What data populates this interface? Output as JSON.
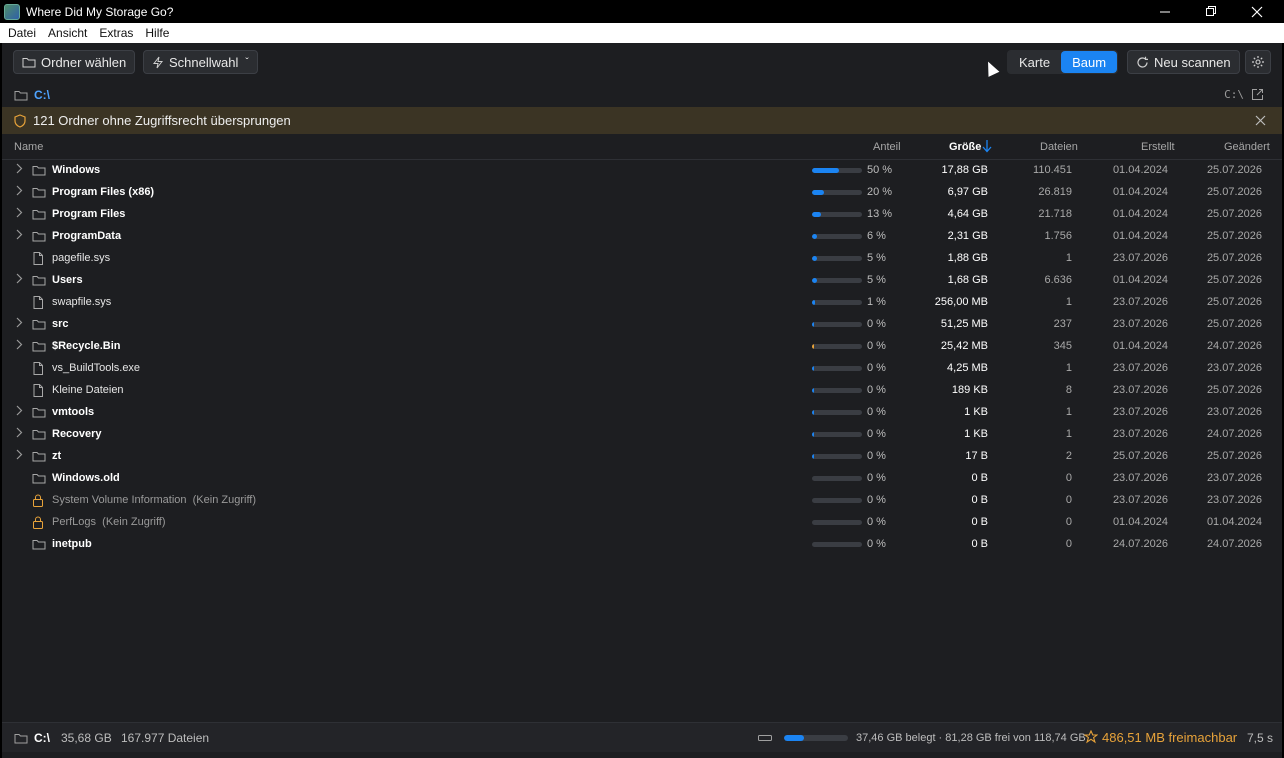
{
  "window": {
    "title": "Where Did My Storage Go?"
  },
  "menu": [
    "Datei",
    "Ansicht",
    "Extras",
    "Hilfe"
  ],
  "toolbar": {
    "choose_folder": "Ordner wählen",
    "quick_select": "Schnellwahl",
    "view_map": "Karte",
    "view_tree": "Baum",
    "rescan": "Neu scannen"
  },
  "path": {
    "current": "C:\\",
    "drive_label": "C:\\"
  },
  "warning": {
    "text": "121 Ordner ohne Zugriffsrecht übersprungen"
  },
  "columns": {
    "name": "Name",
    "share": "Anteil",
    "size": "Größe",
    "files": "Dateien",
    "created": "Erstellt",
    "changed": "Geändert"
  },
  "accent_color": "#1b84f2",
  "warning_color": "#e8a33a",
  "rows": [
    {
      "name": "Windows",
      "type": "folder",
      "expandable": true,
      "share": "50 %",
      "share_value": 0.5,
      "size": "17,88 GB",
      "files": "110.451",
      "created": "01.04.2024",
      "changed": "25.07.2026"
    },
    {
      "name": "Program Files (x86)",
      "type": "folder",
      "expandable": true,
      "share": "20 %",
      "share_value": 0.2,
      "size": "6,97 GB",
      "files": "26.819",
      "created": "01.04.2024",
      "changed": "25.07.2026"
    },
    {
      "name": "Program Files",
      "type": "folder",
      "expandable": true,
      "share": "13 %",
      "share_value": 0.13,
      "size": "4,64 GB",
      "files": "21.718",
      "created": "01.04.2024",
      "changed": "25.07.2026"
    },
    {
      "name": "ProgramData",
      "type": "folder",
      "expandable": true,
      "share": "6 %",
      "share_value": 0.06,
      "size": "2,31 GB",
      "files": "1.756",
      "created": "01.04.2024",
      "changed": "25.07.2026"
    },
    {
      "name": "pagefile.sys",
      "type": "file",
      "expandable": false,
      "share": "5 %",
      "share_value": 0.05,
      "size": "1,88 GB",
      "files": "1",
      "created": "23.07.2026",
      "changed": "25.07.2026"
    },
    {
      "name": "Users",
      "type": "folder",
      "expandable": true,
      "share": "5 %",
      "share_value": 0.05,
      "size": "1,68 GB",
      "files": "6.636",
      "created": "01.04.2024",
      "changed": "25.07.2026"
    },
    {
      "name": "swapfile.sys",
      "type": "file",
      "expandable": false,
      "share": "1 %",
      "share_value": 0.01,
      "size": "256,00 MB",
      "files": "1",
      "created": "23.07.2026",
      "changed": "25.07.2026"
    },
    {
      "name": "src",
      "type": "folder",
      "expandable": true,
      "share": "0 %",
      "share_value": 0.005,
      "size": "51,25 MB",
      "files": "237",
      "created": "23.07.2026",
      "changed": "25.07.2026"
    },
    {
      "name": "$Recycle.Bin",
      "type": "folder",
      "expandable": true,
      "share": "0 %",
      "share_value": 0.005,
      "size": "25,42 MB",
      "files": "345",
      "created": "01.04.2024",
      "changed": "24.07.2026",
      "bar_color": "#e8a33a"
    },
    {
      "name": "vs_BuildTools.exe",
      "type": "file",
      "expandable": false,
      "share": "0 %",
      "share_value": 0.005,
      "size": "4,25 MB",
      "files": "1",
      "created": "23.07.2026",
      "changed": "23.07.2026"
    },
    {
      "name": "Kleine Dateien",
      "type": "file",
      "expandable": false,
      "share": "0 %",
      "share_value": 0.005,
      "size": "189 KB",
      "files": "8",
      "created": "23.07.2026",
      "changed": "25.07.2026"
    },
    {
      "name": "vmtools",
      "type": "folder",
      "expandable": true,
      "share": "0 %",
      "share_value": 0.005,
      "size": "1 KB",
      "files": "1",
      "created": "23.07.2026",
      "changed": "23.07.2026"
    },
    {
      "name": "Recovery",
      "type": "folder",
      "expandable": true,
      "share": "0 %",
      "share_value": 0.005,
      "size": "1 KB",
      "files": "1",
      "created": "23.07.2026",
      "changed": "24.07.2026"
    },
    {
      "name": "zt",
      "type": "folder",
      "expandable": true,
      "share": "0 %",
      "share_value": 0.005,
      "size": "17 B",
      "files": "2",
      "created": "25.07.2026",
      "changed": "25.07.2026"
    },
    {
      "name": "Windows.old",
      "type": "folder",
      "expandable": false,
      "share": "0 %",
      "share_value": 0,
      "size": "0 B",
      "files": "0",
      "created": "23.07.2026",
      "changed": "23.07.2026"
    },
    {
      "name": "System Volume Information",
      "type": "locked",
      "expandable": false,
      "suffix": "(Kein Zugriff)",
      "share": "0 %",
      "share_value": 0,
      "size": "0 B",
      "files": "0",
      "created": "23.07.2026",
      "changed": "23.07.2026"
    },
    {
      "name": "PerfLogs",
      "type": "locked",
      "expandable": false,
      "suffix": "(Kein Zugriff)",
      "share": "0 %",
      "share_value": 0,
      "size": "0 B",
      "files": "0",
      "created": "01.04.2024",
      "changed": "01.04.2024"
    },
    {
      "name": "inetpub",
      "type": "folder",
      "expandable": false,
      "share": "0 %",
      "share_value": 0,
      "size": "0 B",
      "files": "0",
      "created": "24.07.2026",
      "changed": "24.07.2026"
    }
  ],
  "status": {
    "path": "C:\\",
    "total_size": "35,68 GB",
    "file_count": "167.977 Dateien",
    "disk_usage": "37,46 GB belegt · 81,28 GB frei von 118,74 GB",
    "disk_used_fraction": 0.32,
    "freeable": "486,51 MB freimachbar",
    "duration": "7,5 s"
  }
}
